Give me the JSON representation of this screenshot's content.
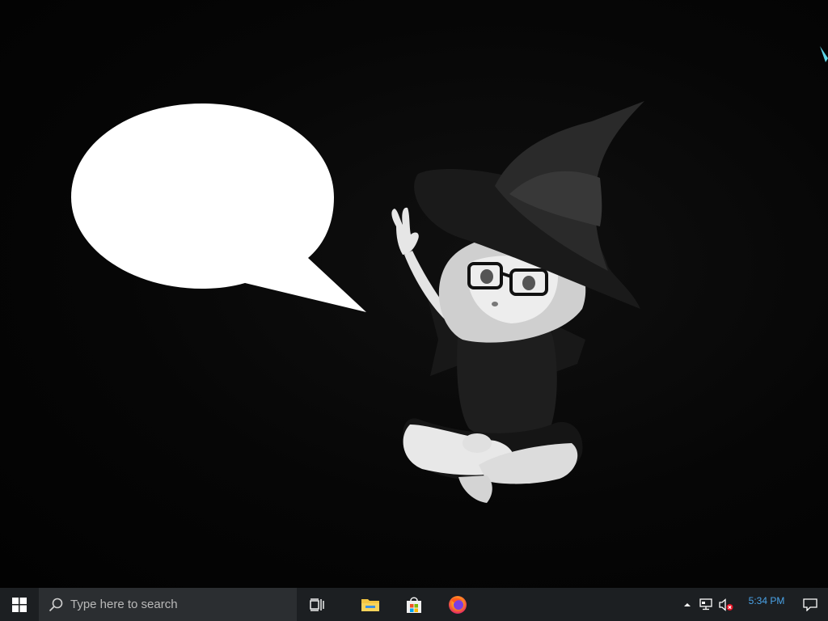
{
  "desktop": {
    "wallpaper": {
      "bubble_text": ""
    }
  },
  "taskbar": {
    "start_icon": "windows-logo",
    "search": {
      "placeholder": "Type here to search",
      "icon": "search-icon"
    },
    "pinned": [
      {
        "name": "task-view",
        "icon": "task-view-icon"
      },
      {
        "name": "file-explorer",
        "icon": "folder-icon"
      },
      {
        "name": "microsoft-store",
        "icon": "store-icon"
      },
      {
        "name": "firefox",
        "icon": "firefox-icon"
      }
    ],
    "tray": {
      "show_hidden": "caret-up-icon",
      "network": "network-icon",
      "volume": "volume-muted-icon",
      "clock": "5:34 PM",
      "notifications": "notification-icon"
    }
  },
  "colors": {
    "taskbar_bg": "#1c1f22",
    "search_bg": "#2b2e31",
    "clock_text": "#4aa3e8",
    "desktop_bg": "#050505"
  }
}
